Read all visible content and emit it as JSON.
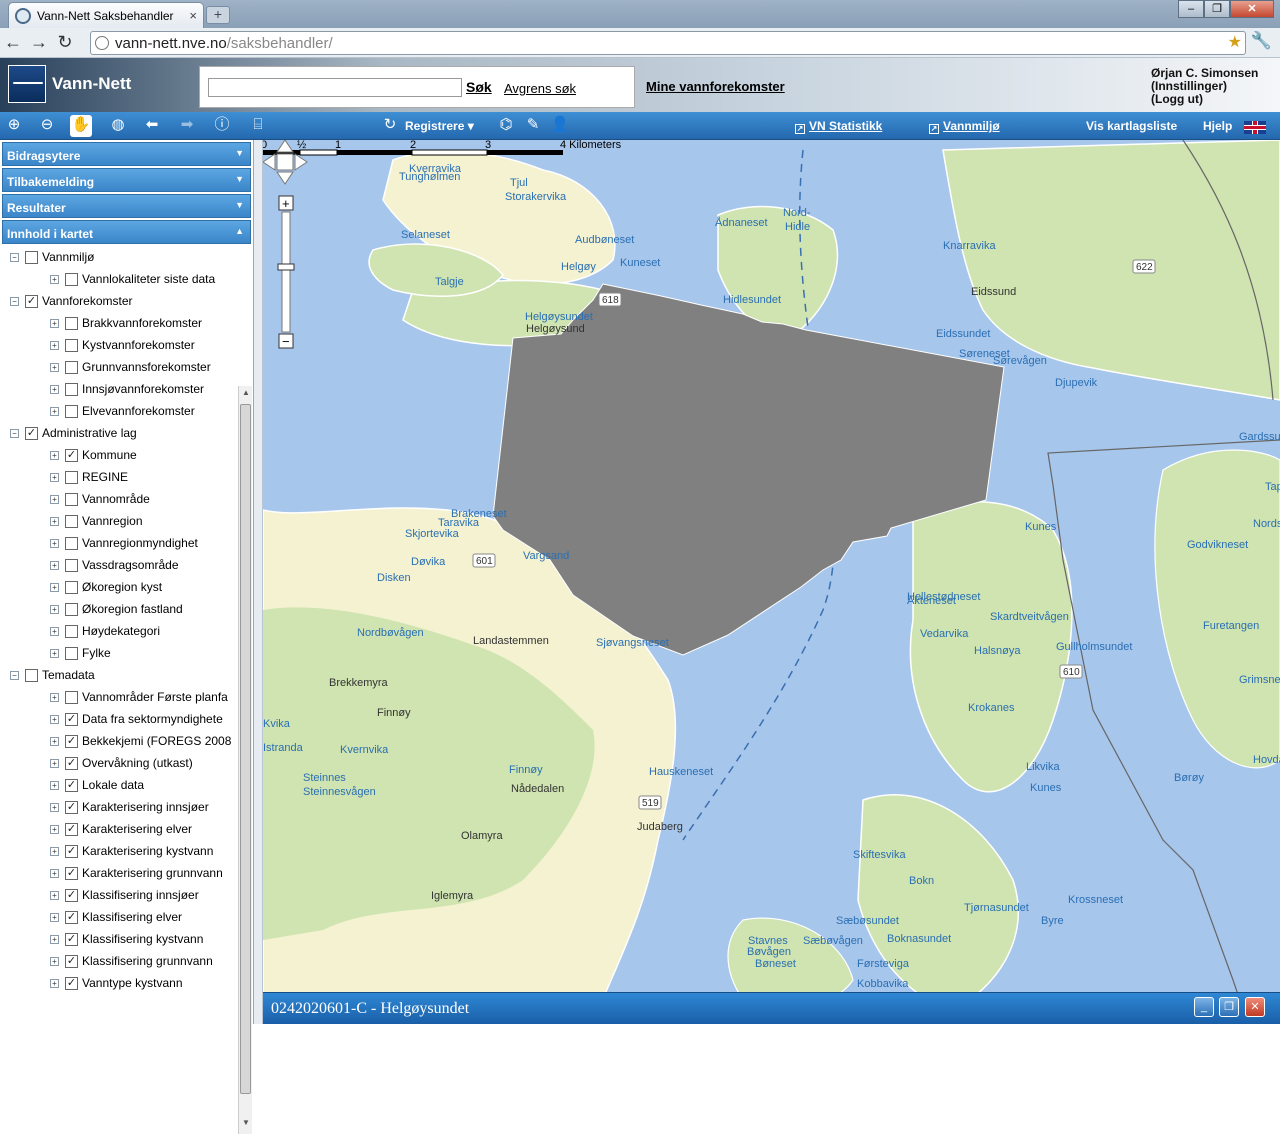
{
  "browser": {
    "tab_title": "Vann-Nett Saksbehandler",
    "url_host": "vann-nett.nve.no",
    "url_path": "/saksbehandler/"
  },
  "header": {
    "app_name": "Vann-Nett",
    "search_button": "Søk",
    "refine_link": "Avgrens søk",
    "my_link": "Mine vannforekomster",
    "user_name": "Ørjan C. Simonsen",
    "settings": "(Innstillinger)",
    "logout": "(Logg ut)"
  },
  "toolbar": {
    "register": "Registrere",
    "stats": "VN Statistikk",
    "water_env": "Vannmiljø",
    "layers_list": "Vis kartlagsliste",
    "help": "Hjelp"
  },
  "panels": [
    "Bidragsytere",
    "Tilbakemelding",
    "Resultater",
    "Innhold i kartet"
  ],
  "tree": [
    {
      "label": "Vannmiljø",
      "level": 0,
      "checked": false
    },
    {
      "label": "Vannlokaliteter siste data",
      "level": 1,
      "checked": false
    },
    {
      "label": "Vannforekomster",
      "level": 0,
      "checked": true
    },
    {
      "label": "Brakkvannforekomster",
      "level": 1,
      "checked": false
    },
    {
      "label": "Kystvannforekomster",
      "level": 1,
      "checked": false
    },
    {
      "label": "Grunnvannsforekomster",
      "level": 1,
      "checked": false
    },
    {
      "label": "Innsjøvannforekomster",
      "level": 1,
      "checked": false
    },
    {
      "label": "Elvevannforekomster",
      "level": 1,
      "checked": false
    },
    {
      "label": "Administrative lag",
      "level": 0,
      "checked": true
    },
    {
      "label": "Kommune",
      "level": 1,
      "checked": true
    },
    {
      "label": "REGINE",
      "level": 1,
      "checked": false
    },
    {
      "label": "Vannområde",
      "level": 1,
      "checked": false
    },
    {
      "label": "Vannregion",
      "level": 1,
      "checked": false
    },
    {
      "label": "Vannregionmyndighet",
      "level": 1,
      "checked": false
    },
    {
      "label": "Vassdragsområde",
      "level": 1,
      "checked": false
    },
    {
      "label": "Økoregion kyst",
      "level": 1,
      "checked": false
    },
    {
      "label": "Økoregion fastland",
      "level": 1,
      "checked": false
    },
    {
      "label": "Høydekategori",
      "level": 1,
      "checked": false
    },
    {
      "label": "Fylke",
      "level": 1,
      "checked": false
    },
    {
      "label": "Temadata",
      "level": 0,
      "checked": false
    },
    {
      "label": "Vannområder Første planfa",
      "level": 1,
      "checked": false
    },
    {
      "label": "Data fra sektormyndighete",
      "level": 1,
      "checked": true
    },
    {
      "label": "Bekkekjemi (FOREGS 2008",
      "level": 1,
      "checked": true
    },
    {
      "label": "Overvåkning (utkast)",
      "level": 1,
      "checked": true
    },
    {
      "label": "Lokale data",
      "level": 1,
      "checked": true
    },
    {
      "label": "Karakterisering innsjøer",
      "level": 1,
      "checked": true
    },
    {
      "label": "Karakterisering elver",
      "level": 1,
      "checked": true
    },
    {
      "label": "Karakterisering kystvann",
      "level": 1,
      "checked": true
    },
    {
      "label": "Karakterisering grunnvann",
      "level": 1,
      "checked": true
    },
    {
      "label": "Klassifisering innsjøer",
      "level": 1,
      "checked": true
    },
    {
      "label": "Klassifisering elver",
      "level": 1,
      "checked": true
    },
    {
      "label": "Klassifisering kystvann",
      "level": 1,
      "checked": true
    },
    {
      "label": "Klassifisering grunnvann",
      "level": 1,
      "checked": true
    },
    {
      "label": "Vanntype kystvann",
      "level": 1,
      "checked": true
    }
  ],
  "map": {
    "scale_labels": [
      "0",
      "½",
      "1",
      "2",
      "3",
      "4 Kilometers"
    ],
    "places": [
      {
        "name": "Kverravika",
        "kind": "water"
      },
      {
        "name": "Tjul",
        "kind": "water"
      },
      {
        "name": "Tunghølmen",
        "kind": "water"
      },
      {
        "name": "Storakervika",
        "kind": "water"
      },
      {
        "name": "Ådnaneset",
        "kind": "water"
      },
      {
        "name": "Nord-",
        "kind": "water"
      },
      {
        "name": "Hidle",
        "kind": "water"
      },
      {
        "name": "Selaneset",
        "kind": "water"
      },
      {
        "name": "Audbøneset",
        "kind": "water"
      },
      {
        "name": "Helgøy",
        "kind": "water"
      },
      {
        "name": "Kuneset",
        "kind": "water"
      },
      {
        "name": "Talgje",
        "kind": "water"
      },
      {
        "name": "Helgøysundet",
        "kind": "water"
      },
      {
        "name": "Helgøysund",
        "kind": "land"
      },
      {
        "name": "Hidlesundet",
        "kind": "water"
      },
      {
        "name": "Knarravika",
        "kind": "water"
      },
      {
        "name": "Eidssund",
        "kind": "land"
      },
      {
        "name": "Eidssundet",
        "kind": "water"
      },
      {
        "name": "Søreneset",
        "kind": "water"
      },
      {
        "name": "Sørevågen",
        "kind": "water"
      },
      {
        "name": "Djupevik",
        "kind": "water"
      },
      {
        "name": "Gardssund",
        "kind": "water"
      },
      {
        "name": "Tapp",
        "kind": "water"
      },
      {
        "name": "Nordstø",
        "kind": "water"
      },
      {
        "name": "Godvikneset",
        "kind": "water"
      },
      {
        "name": "Brakeneset",
        "kind": "water"
      },
      {
        "name": "Taravika",
        "kind": "water"
      },
      {
        "name": "Skjortevika",
        "kind": "water"
      },
      {
        "name": "Døvika",
        "kind": "water"
      },
      {
        "name": "Vargsand",
        "kind": "water"
      },
      {
        "name": "Disken",
        "kind": "water"
      },
      {
        "name": "Nordbøvågen",
        "kind": "water"
      },
      {
        "name": "Landastemmen",
        "kind": "land"
      },
      {
        "name": "Sjøvangsneset",
        "kind": "water"
      },
      {
        "name": "Brekkemyra",
        "kind": "land"
      },
      {
        "name": "Finnøy",
        "kind": "land"
      },
      {
        "name": "Kvernvika",
        "kind": "water"
      },
      {
        "name": "Steinnes",
        "kind": "water"
      },
      {
        "name": "Steinnesvågen",
        "kind": "water"
      },
      {
        "name": "Finnøy",
        "kind": "water"
      },
      {
        "name": "Nådedalen",
        "kind": "land"
      },
      {
        "name": "Hauskeneset",
        "kind": "water"
      },
      {
        "name": "Olamyra",
        "kind": "land"
      },
      {
        "name": "Judaberg",
        "kind": "land"
      },
      {
        "name": "Iglemyra",
        "kind": "land"
      },
      {
        "name": "Kunes",
        "kind": "water"
      },
      {
        "name": "Hellestødneset",
        "kind": "water"
      },
      {
        "name": "Akteneset",
        "kind": "water"
      },
      {
        "name": "Vedarvika",
        "kind": "water"
      },
      {
        "name": "Skardtveitvågen",
        "kind": "water"
      },
      {
        "name": "Halsnøya",
        "kind": "water"
      },
      {
        "name": "Gullholmsundet",
        "kind": "water"
      },
      {
        "name": "Furetangen",
        "kind": "water"
      },
      {
        "name": "Grimsnes",
        "kind": "water"
      },
      {
        "name": "Krokanes",
        "kind": "water"
      },
      {
        "name": "Likvika",
        "kind": "water"
      },
      {
        "name": "Kunes",
        "kind": "water"
      },
      {
        "name": "Hovdane",
        "kind": "water"
      },
      {
        "name": "Børøy",
        "kind": "water"
      },
      {
        "name": "Skiftesvika",
        "kind": "water"
      },
      {
        "name": "Bokn",
        "kind": "water"
      },
      {
        "name": "Tjørnasundet",
        "kind": "water"
      },
      {
        "name": "Krossneset",
        "kind": "water"
      },
      {
        "name": "Byre",
        "kind": "water"
      },
      {
        "name": "Sæbøsundet",
        "kind": "water"
      },
      {
        "name": "Boknasundet",
        "kind": "water"
      },
      {
        "name": "Stavnes",
        "kind": "water"
      },
      {
        "name": "Sæbøvågen",
        "kind": "water"
      },
      {
        "name": "Bøvågen",
        "kind": "water"
      },
      {
        "name": "Bøneset",
        "kind": "water"
      },
      {
        "name": "Førsteviga",
        "kind": "water"
      },
      {
        "name": "Kobbavika",
        "kind": "water"
      },
      {
        "name": "Kvika",
        "kind": "water"
      },
      {
        "name": "Istrandа",
        "kind": "water"
      }
    ],
    "roads": [
      "618",
      "622",
      "601",
      "610",
      "519"
    ]
  },
  "info": {
    "title": "0242020601-C - Helgøysundet"
  },
  "colors": {
    "sea": "#a7c6ec",
    "land": "#f4f2d0",
    "forest": "#cfe4b0",
    "selection": "#808080",
    "toolbar": "#2f7cc4"
  }
}
